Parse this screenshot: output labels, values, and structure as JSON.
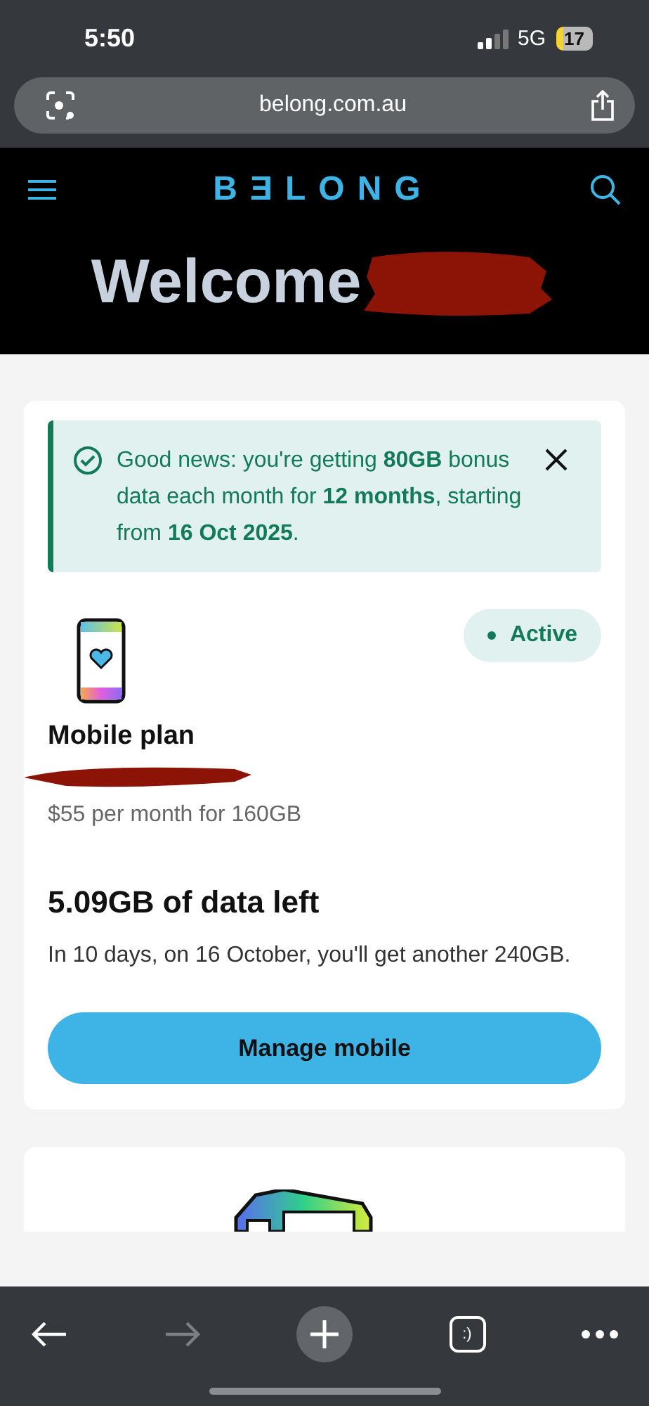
{
  "status_bar": {
    "time": "5:50",
    "network": "5G",
    "battery": "17"
  },
  "address_bar": {
    "url": "belong.com.au"
  },
  "header": {
    "logo": "BƎLONG",
    "welcome": "Welcome"
  },
  "notice": {
    "text": "Good news: you're getting **80GB** bonus data each month for **12 months**, starting from **16 Oct 2025**."
  },
  "plan": {
    "status": "Active",
    "title": "Mobile plan",
    "price": "$55 per month for 160GB",
    "data_left": "5.09GB of data left",
    "renewal": "In 10 days, on 16 October, you'll get another 240GB.",
    "button": "Manage mobile"
  },
  "toolbar": [
    {
      "kind": "back",
      "disabled": false
    },
    {
      "kind": "forward",
      "disabled": true
    },
    {
      "kind": "new-tab",
      "disabled": false
    },
    {
      "kind": "tabs",
      "label": ":)",
      "disabled": false
    },
    {
      "kind": "more",
      "disabled": false
    }
  ]
}
